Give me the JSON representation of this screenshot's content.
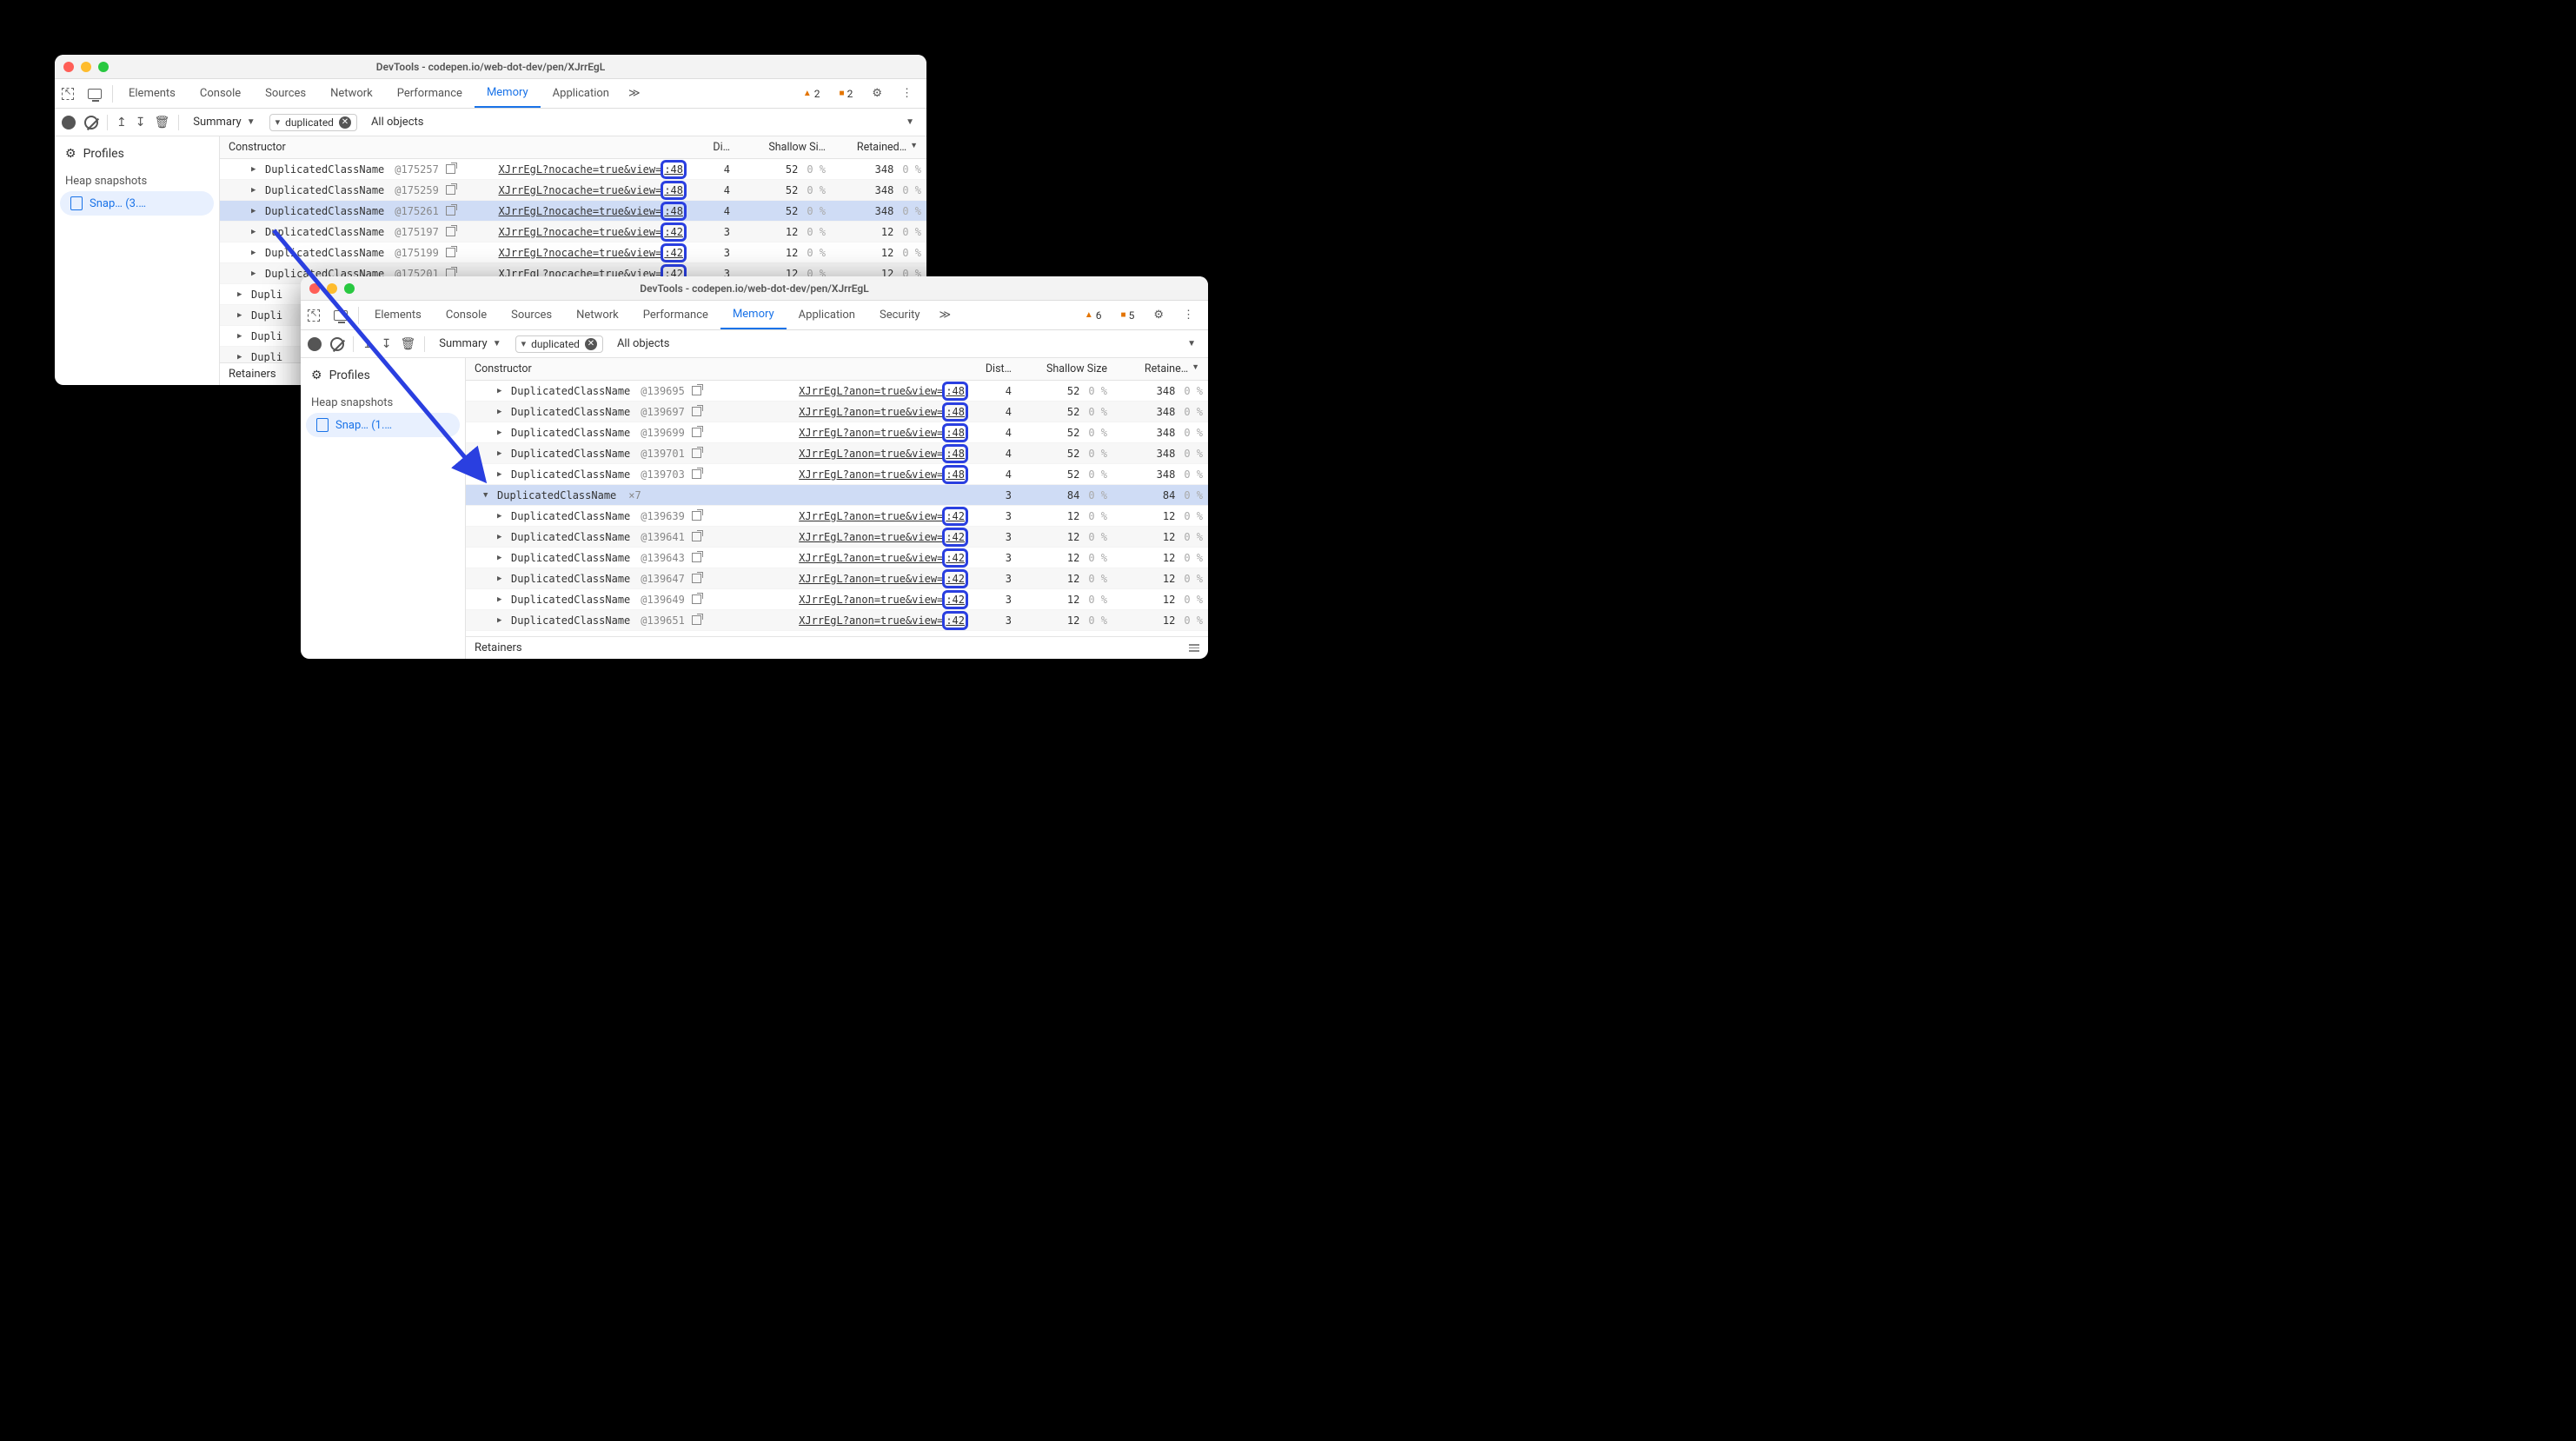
{
  "windows": {
    "back": {
      "title": "DevTools - codepen.io/web-dot-dev/pen/XJrrEgL",
      "tabs": [
        "Elements",
        "Console",
        "Sources",
        "Network",
        "Performance",
        "Memory",
        "Application"
      ],
      "active_tab": "Memory",
      "warnings": 2,
      "issues": 2,
      "summary_dropdown": "Summary",
      "filter_text": "duplicated",
      "objects_dropdown": "All objects",
      "sidebar": {
        "profiles_label": "Profiles",
        "heap_label": "Heap snapshots",
        "snapshot_label": "Snap…  (3.…"
      },
      "columns": {
        "constructor": "Constructor",
        "distance": "Di…",
        "shallow": "Shallow Si…",
        "retained": "Retained…"
      },
      "rows": [
        {
          "indent": 1,
          "name": "DuplicatedClassName",
          "id": "@175257",
          "src": "XJrrEgL?nocache=true&view=",
          "line": ":48",
          "dist": 4,
          "shallow": 52,
          "retained": 348,
          "alt": false
        },
        {
          "indent": 1,
          "name": "DuplicatedClassName",
          "id": "@175259",
          "src": "XJrrEgL?nocache=true&view=",
          "line": ":48",
          "dist": 4,
          "shallow": 52,
          "retained": 348,
          "alt": true
        },
        {
          "indent": 1,
          "name": "DuplicatedClassName",
          "id": "@175261",
          "src": "XJrrEgL?nocache=true&view=",
          "line": ":48",
          "dist": 4,
          "shallow": 52,
          "retained": 348,
          "alt": false,
          "selected": true
        },
        {
          "indent": 1,
          "name": "DuplicatedClassName",
          "id": "@175197",
          "src": "XJrrEgL?nocache=true&view=",
          "line": ":42",
          "dist": 3,
          "shallow": 12,
          "retained": 12,
          "alt": true
        },
        {
          "indent": 1,
          "name": "DuplicatedClassName",
          "id": "@175199",
          "src": "XJrrEgL?nocache=true&view=",
          "line": ":42",
          "dist": 3,
          "shallow": 12,
          "retained": 12,
          "alt": false
        },
        {
          "indent": 1,
          "name": "DuplicatedClassName",
          "id": "@175201",
          "src": "XJrrEgL?nocache=true&view=",
          "line": ":42",
          "dist": 3,
          "shallow": 12,
          "retained": 12,
          "alt": true
        },
        {
          "indent": 0,
          "name": "Dupli",
          "partial": true,
          "alt": false
        },
        {
          "indent": 0,
          "name": "Dupli",
          "partial": true,
          "alt": true
        },
        {
          "indent": 0,
          "name": "Dupli",
          "partial": true,
          "alt": false
        },
        {
          "indent": 0,
          "name": "Dupli",
          "partial": true,
          "alt": true
        }
      ],
      "retainers_label": "Retainers"
    },
    "front": {
      "title": "DevTools - codepen.io/web-dot-dev/pen/XJrrEgL",
      "tabs": [
        "Elements",
        "Console",
        "Sources",
        "Network",
        "Performance",
        "Memory",
        "Application",
        "Security"
      ],
      "active_tab": "Memory",
      "warnings": 6,
      "issues": 5,
      "summary_dropdown": "Summary",
      "filter_text": "duplicated",
      "objects_dropdown": "All objects",
      "sidebar": {
        "profiles_label": "Profiles",
        "heap_label": "Heap snapshots",
        "snapshot_label": "Snap…  (1.…"
      },
      "columns": {
        "constructor": "Constructor",
        "distance": "Dist…",
        "shallow": "Shallow Size",
        "retained": "Retaine…"
      },
      "rows": [
        {
          "indent": 1,
          "name": "DuplicatedClassName",
          "id": "@139695",
          "src": "XJrrEgL?anon=true&view=",
          "line": ":48",
          "dist": 4,
          "shallow": 52,
          "retained": 348,
          "alt": false
        },
        {
          "indent": 1,
          "name": "DuplicatedClassName",
          "id": "@139697",
          "src": "XJrrEgL?anon=true&view=",
          "line": ":48",
          "dist": 4,
          "shallow": 52,
          "retained": 348,
          "alt": true
        },
        {
          "indent": 1,
          "name": "DuplicatedClassName",
          "id": "@139699",
          "src": "XJrrEgL?anon=true&view=",
          "line": ":48",
          "dist": 4,
          "shallow": 52,
          "retained": 348,
          "alt": false
        },
        {
          "indent": 1,
          "name": "DuplicatedClassName",
          "id": "@139701",
          "src": "XJrrEgL?anon=true&view=",
          "line": ":48",
          "dist": 4,
          "shallow": 52,
          "retained": 348,
          "alt": true
        },
        {
          "indent": 1,
          "name": "DuplicatedClassName",
          "id": "@139703",
          "src": "XJrrEgL?anon=true&view=",
          "line": ":48",
          "dist": 4,
          "shallow": 52,
          "retained": 348,
          "alt": false
        },
        {
          "indent": 0,
          "name": "DuplicatedClassName",
          "count": "×7",
          "group": true,
          "dist": 3,
          "shallow": 84,
          "retained": 84,
          "alt": false,
          "selected": true,
          "open": true
        },
        {
          "indent": 1,
          "name": "DuplicatedClassName",
          "id": "@139639",
          "src": "XJrrEgL?anon=true&view=",
          "line": ":42",
          "dist": 3,
          "shallow": 12,
          "retained": 12,
          "alt": false
        },
        {
          "indent": 1,
          "name": "DuplicatedClassName",
          "id": "@139641",
          "src": "XJrrEgL?anon=true&view=",
          "line": ":42",
          "dist": 3,
          "shallow": 12,
          "retained": 12,
          "alt": true
        },
        {
          "indent": 1,
          "name": "DuplicatedClassName",
          "id": "@139643",
          "src": "XJrrEgL?anon=true&view=",
          "line": ":42",
          "dist": 3,
          "shallow": 12,
          "retained": 12,
          "alt": false
        },
        {
          "indent": 1,
          "name": "DuplicatedClassName",
          "id": "@139647",
          "src": "XJrrEgL?anon=true&view=",
          "line": ":42",
          "dist": 3,
          "shallow": 12,
          "retained": 12,
          "alt": true
        },
        {
          "indent": 1,
          "name": "DuplicatedClassName",
          "id": "@139649",
          "src": "XJrrEgL?anon=true&view=",
          "line": ":42",
          "dist": 3,
          "shallow": 12,
          "retained": 12,
          "alt": false
        },
        {
          "indent": 1,
          "name": "DuplicatedClassName",
          "id": "@139651",
          "src": "XJrrEgL?anon=true&view=",
          "line": ":42",
          "dist": 3,
          "shallow": 12,
          "retained": 12,
          "alt": true
        }
      ],
      "retainers_label": "Retainers"
    }
  },
  "pct_label": "0 %"
}
